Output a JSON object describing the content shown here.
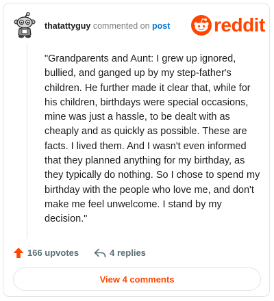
{
  "comment": {
    "author": "thatattyguy",
    "action_text": "commented on",
    "post_link_text": "post",
    "body": "\"Grandparents and Aunt: I grew up ignored, bullied, and ganged up by my step-father's children. He further made it clear that, while for his children, birthdays were special occasions, mine was just a hassle, to be dealt with as cheaply and as quickly as possible. These are facts. I lived them. And I wasn't even informed that they planned anything for my birthday, as they typically do nothing. So I chose to spend my birthday with the people who love me, and don't make me feel unwelcome. I stand by my decision.\""
  },
  "brand": {
    "wordmark": "reddit",
    "color": "#ff4500"
  },
  "actions": {
    "upvotes_label": "166 upvotes",
    "replies_label": "4 replies"
  },
  "view_button_label": "View 4 comments",
  "icons": {
    "avatar": "snoo-avatar",
    "logo": "reddit-logo-icon",
    "upvote": "upvote-arrow-icon",
    "reply": "reply-arrow-icon"
  }
}
